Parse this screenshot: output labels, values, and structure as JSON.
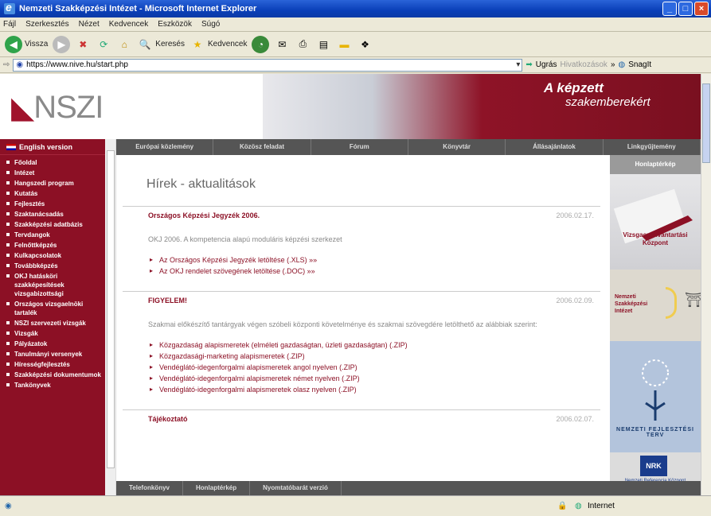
{
  "window": {
    "title": "Nemzeti Szakképzési Intézet - Microsoft Internet Explorer"
  },
  "menu": [
    "Fájl",
    "Szerkesztés",
    "Nézet",
    "Kedvencek",
    "Eszközök",
    "Súgó"
  ],
  "toolbar": {
    "back": "Vissza",
    "search": "Keresés",
    "favorites": "Kedvencek"
  },
  "address": {
    "url": "https://www.nive.hu/start.php",
    "go": "Ugrás",
    "links": "Hivatkozások",
    "snagit": "SnagIt"
  },
  "header": {
    "logo": "NSZI",
    "slogan1": "A képzett",
    "slogan2": "szakemberekért"
  },
  "leftnav": {
    "english": "English version",
    "items": [
      "Főoldal",
      "Intézet",
      "Hangszedi program",
      "Kutatás",
      "Fejlesztés",
      "Szaktanácsadás",
      "Szakképzési adatbázis",
      "Tervdangok",
      "Felnőttképzés",
      "Kulkapcsolatok",
      "Továbbképzés",
      "OKJ hatásköri szakképesítések vizsgabizottsági",
      "Országos vizsgaelnöki tartalék",
      "NSZI szervezeti vizsgák",
      "Vizsgák",
      "Pályázatok",
      "Tanulmányi versenyek",
      "Hírességfejlesztés",
      "Szakképzési dokumentumok",
      "Tankönyvek"
    ]
  },
  "topnav": [
    "Európai közlemény",
    "Közösz feladat",
    "Fórum",
    "Könyvtár",
    "Állásajánlatok",
    "Linkgyűjtemény"
  ],
  "content": {
    "title": "Hírek - aktualitások",
    "news": [
      {
        "title": "Országos Képzési Jegyzék 2006.",
        "date": "2006.02.17.",
        "text": "OKJ 2006. A kompetencia alapú moduláris képzési szerkezet",
        "links": [
          "Az Országos Képzési Jegyzék letöltése (.XLS) »»",
          "Az OKJ rendelet szövegének letöltése (.DOC) »»"
        ]
      },
      {
        "title": "FIGYELEM!",
        "date": "2006.02.09.",
        "text": "Szakmai előkészítő tantárgyak végen szóbeli központi követelménye és szakmai szövegdére letölthető az alábbiak szerint:",
        "links": [
          "Közgazdaság alapismeretek (elméleti gazdaságtan, üzleti gazdaságtan) (.ZIP)",
          "Közgazdasági-marketing alapismeretek (.ZIP)",
          "Vendéglátó-idegenforgalmi alapismeretek angol nyelven (.ZIP)",
          "Vendéglátó-idegenforgalmi alapismeretek német nyelven (.ZIP)",
          "Vendéglátó-idegenforgalmi alapismeretek olasz nyelven (.ZIP)"
        ]
      },
      {
        "title": "Tájékoztató",
        "date": "2006.02.07.",
        "text": "",
        "links": []
      }
    ]
  },
  "right": {
    "header": "Honlaptérkép",
    "vizsga": "Vizsgaenyilvántartási Központ",
    "nszi": "Nemzeti Szakképzési Intézet",
    "nrk": "NRK",
    "nrk_sub": "Nemzeti Referencia Központ MAGYARORSZÁG",
    "alliance": "NEMZETI FEJLESZTÉSI TERV"
  },
  "bottomnav": [
    "Telefonkönyv",
    "Honlaptérkép",
    "Nyomtatóbarát verzió"
  ],
  "status": {
    "zone": "Internet"
  }
}
